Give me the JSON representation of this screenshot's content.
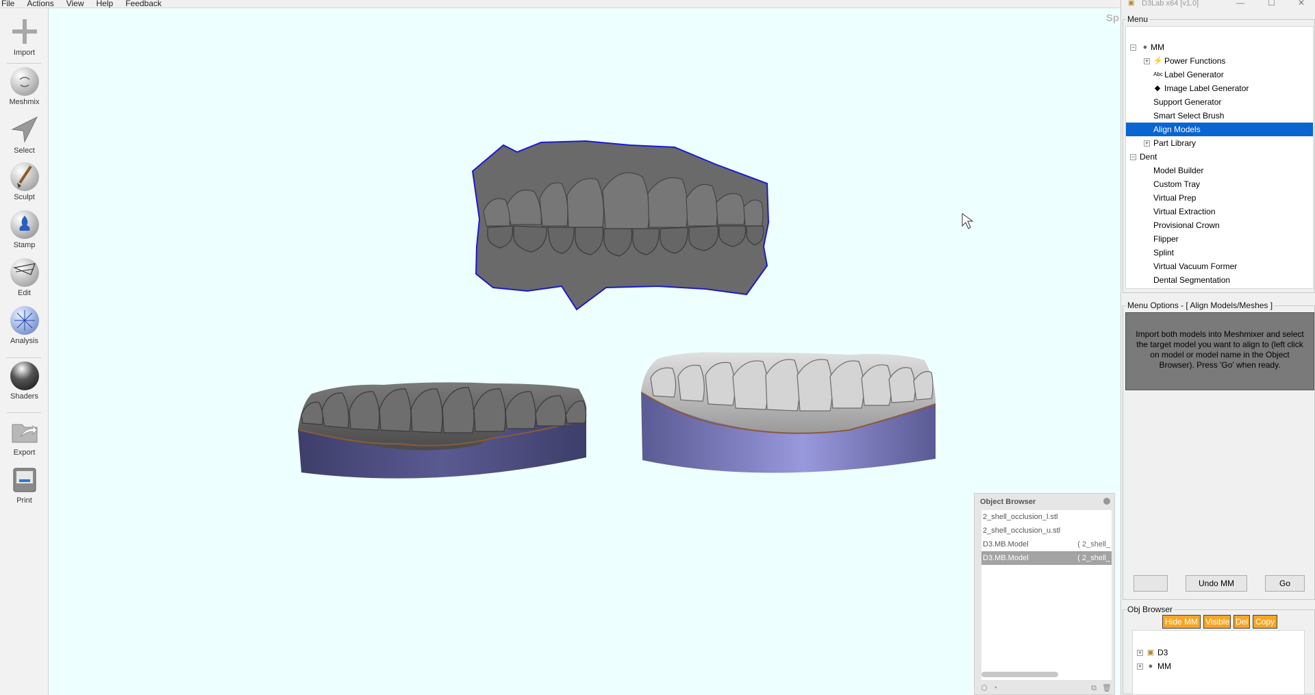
{
  "menubar": {
    "items": [
      "File",
      "Actions",
      "View",
      "Help",
      "Feedback"
    ]
  },
  "toolbar": {
    "tools": [
      {
        "label": "Import",
        "icon": "plus-icon"
      },
      {
        "label": "Meshmix",
        "icon": "meshmix-sphere-icon"
      },
      {
        "label": "Select",
        "icon": "select-arrow-icon"
      },
      {
        "label": "Sculpt",
        "icon": "sculpt-brush-icon"
      },
      {
        "label": "Stamp",
        "icon": "stamp-icon"
      },
      {
        "label": "Edit",
        "icon": "edit-sphere-icon"
      },
      {
        "label": "Analysis",
        "icon": "analysis-sphere-icon"
      },
      {
        "label": "Shaders",
        "icon": "shaders-sphere-icon"
      },
      {
        "label": "Export",
        "icon": "export-icon"
      },
      {
        "label": "Print",
        "icon": "print-icon"
      }
    ]
  },
  "viewport": {
    "corner_label": "Sp"
  },
  "object_browser": {
    "title": "Object Browser",
    "rows": [
      {
        "name": "2_shell_occlusion_l.stl",
        "side": "",
        "selected": false
      },
      {
        "name": "2_shell_occlusion_u.stl",
        "side": "",
        "selected": false
      },
      {
        "name": "D3.MB.Model",
        "side": "( 2_shell_",
        "selected": false
      },
      {
        "name": "D3.MB.Model",
        "side": "( 2_shell_",
        "selected": true
      }
    ]
  },
  "d3": {
    "window_title": "D3Lab x64 [v1.0]",
    "menu_legend": "Menu",
    "tree": [
      {
        "label": "MM",
        "level": 0,
        "expander": "−",
        "icon": "mm-sphere-icon",
        "selected": false
      },
      {
        "label": "Power Functions",
        "level": 1,
        "expander": "+",
        "icon": "lightning-icon",
        "selected": false
      },
      {
        "label": "Label Generator",
        "level": 1,
        "expander": "",
        "icon": "abc-icon",
        "selected": false
      },
      {
        "label": "Image Label Generator",
        "level": 1,
        "expander": "",
        "icon": "diamond-icon",
        "selected": false
      },
      {
        "label": "Support Generator",
        "level": 1,
        "expander": "",
        "icon": "",
        "selected": false
      },
      {
        "label": "Smart Select Brush",
        "level": 1,
        "expander": "",
        "icon": "",
        "selected": false
      },
      {
        "label": "Align Models",
        "level": 1,
        "expander": "",
        "icon": "",
        "selected": true
      },
      {
        "label": "Part Library",
        "level": 1,
        "expander": "+",
        "icon": "",
        "selected": false
      },
      {
        "label": "Dent",
        "level": 0,
        "expander": "−",
        "icon": "",
        "selected": false
      },
      {
        "label": "Model Builder",
        "level": 1,
        "expander": "",
        "icon": "",
        "selected": false
      },
      {
        "label": "Custom Tray",
        "level": 1,
        "expander": "",
        "icon": "",
        "selected": false
      },
      {
        "label": "Virtual Prep",
        "level": 1,
        "expander": "",
        "icon": "",
        "selected": false
      },
      {
        "label": "Virtual Extraction",
        "level": 1,
        "expander": "",
        "icon": "",
        "selected": false
      },
      {
        "label": "Provisional Crown",
        "level": 1,
        "expander": "",
        "icon": "",
        "selected": false
      },
      {
        "label": "Flipper",
        "level": 1,
        "expander": "",
        "icon": "",
        "selected": false
      },
      {
        "label": "Splint",
        "level": 1,
        "expander": "",
        "icon": "",
        "selected": false
      },
      {
        "label": "Virtual Vacuum Former",
        "level": 1,
        "expander": "",
        "icon": "",
        "selected": false
      },
      {
        "label": "Dental Segmentation",
        "level": 1,
        "expander": "",
        "icon": "",
        "selected": false
      }
    ],
    "menu_options_legend": "Menu Options - [ Align Models/Meshes ]",
    "instructions": "Import both models into Meshmixer and select the target model you want to align to (left click on model or model name in the Object Browser). Press 'Go' when ready.",
    "buttons": {
      "blank": "",
      "undo": "Undo MM",
      "go": "Go"
    },
    "obj_browser_legend": "Obj Browser",
    "obj_buttons": [
      "Hide MM",
      "Visible",
      "Del",
      "Copy"
    ],
    "obj_tree": [
      {
        "label": "D3",
        "icon": "d3-icon"
      },
      {
        "label": "MM",
        "icon": "mm-sphere-icon"
      }
    ]
  }
}
